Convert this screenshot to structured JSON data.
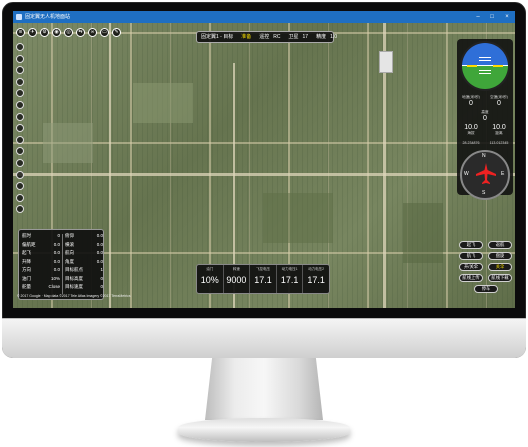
{
  "window": {
    "title": "固定翼无人机地面站"
  },
  "status_bar": {
    "link_label": "固定翼1 - 目标",
    "link_state": "准备",
    "items": [
      {
        "label": "遥控",
        "value": "RC"
      },
      {
        "label": "卫星",
        "value": "17"
      },
      {
        "label": "精度",
        "value": "1.0"
      }
    ]
  },
  "hud": {
    "cells": [
      {
        "label": "油门",
        "value": "10%"
      },
      {
        "label": "转速",
        "value": "9000"
      },
      {
        "label": "飞控电压",
        "value": "17.1"
      },
      {
        "label": "动力电压1",
        "value": "17.1"
      },
      {
        "label": "动力电压2",
        "value": "17.1"
      }
    ]
  },
  "params": {
    "left": [
      {
        "label": "航时",
        "value": "0"
      },
      {
        "label": "偏航距",
        "value": "0.0"
      },
      {
        "label": "起飞",
        "value": "0.0"
      },
      {
        "label": "升降",
        "value": "0.0"
      },
      {
        "label": "方向",
        "value": "0.0"
      },
      {
        "label": "油门",
        "value": "10%"
      },
      {
        "label": "舵量",
        "value": "Close"
      }
    ],
    "right": [
      {
        "label": "俯仰",
        "value": "0.0"
      },
      {
        "label": "横滚",
        "value": "0.0"
      },
      {
        "label": "航向",
        "value": "0.0"
      },
      {
        "label": "角度",
        "value": "0.0"
      },
      {
        "label": "目标航点",
        "value": "1"
      },
      {
        "label": "目标高度",
        "value": "0"
      },
      {
        "label": "目标速度",
        "value": "0"
      }
    ]
  },
  "gauges": {
    "pitch_deg": 0,
    "roll_deg": 0,
    "ground_speed_label": "地速(米/秒)",
    "air_speed_label": "空速(米/秒)",
    "ground_speed": "0",
    "air_speed": "0",
    "height_label": "高度",
    "height": "0",
    "altitude_label": "海拔",
    "distance_label": "距离",
    "altitude": "10.0",
    "distance": "10.0",
    "lat": "28.234876",
    "lon": "113.012345",
    "heading_deg": 0
  },
  "actions": [
    {
      "label": "起飞",
      "style": "normal"
    },
    {
      "label": "返航",
      "style": "normal"
    },
    {
      "label": "航飞",
      "style": "normal"
    },
    {
      "label": "盘旋",
      "style": "normal"
    },
    {
      "label": "开/关伞",
      "style": "normal"
    },
    {
      "label": "关伞",
      "style": "yellowtext"
    },
    {
      "label": "航线上传",
      "style": "normal"
    },
    {
      "label": "航线下载",
      "style": "normal"
    },
    {
      "label": "停车",
      "style": "normal"
    }
  ],
  "map": {
    "copyright": "© 2017 Google · Map data ©2017 Tele Atlas Imagery ©2017 TerraMetrics"
  }
}
